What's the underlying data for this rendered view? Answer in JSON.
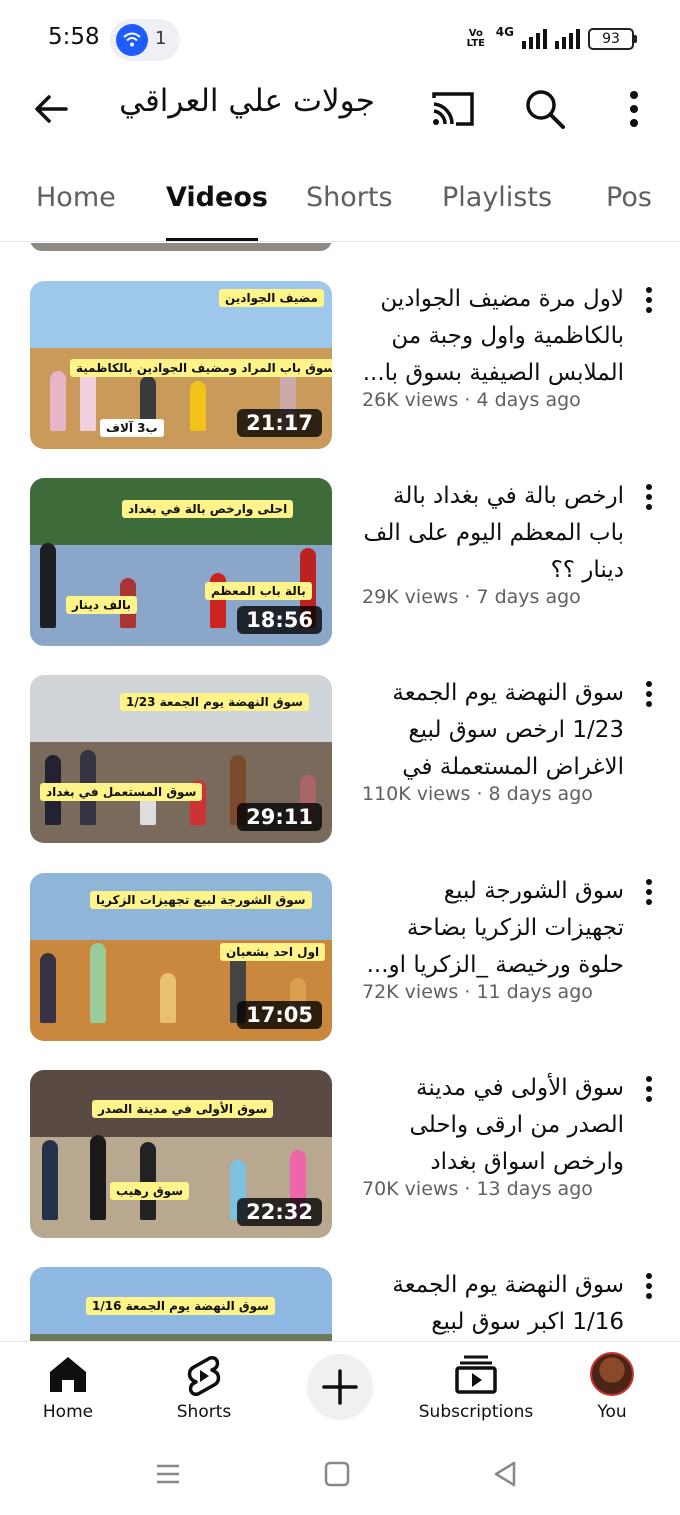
{
  "status_bar": {
    "time": "5:58",
    "notification_count": "1",
    "volte_label": "Vo LTE",
    "network_label": "4G",
    "battery": "93"
  },
  "header": {
    "channel_title": "جولات علي العراقي",
    "icons": [
      "back-arrow-icon",
      "cast-icon",
      "search-icon",
      "more-vert-icon"
    ]
  },
  "tabs": [
    {
      "label": "Home"
    },
    {
      "label": "Videos",
      "active": true
    },
    {
      "label": "Shorts"
    },
    {
      "label": "Playlists"
    },
    {
      "label": "Pos"
    }
  ],
  "videos": [
    {
      "title": "لاول مرة مضيف الجوادين بالكاظمية واول وجبة من الملابس الصيفية بسوق با...",
      "meta": "26K views · 4 days ago",
      "duration": "21:17",
      "banners": [
        "سوق باب المراد ومضيف الجوادين بالكاظمية",
        "مضيف الجوادين",
        "ب3 آلاف"
      ],
      "colors": {
        "sky": "#9ec7ec",
        "ground": "#c99a5a"
      }
    },
    {
      "title": "ارخص بالة في بغداد بالة باب المعظم اليوم على الف دينار ؟؟",
      "meta": "29K views · 7 days ago",
      "duration": "18:56",
      "banners": [
        "احلى وارخص بالة في بغداد",
        "بالة باب المعظم",
        "بالف دينار"
      ],
      "colors": {
        "sky": "#3d6b3a",
        "ground": "#8aa6c8"
      }
    },
    {
      "title": "سوق النهضة يوم الجمعة 1/23 ارخص سوق لبيع الاغراض المستعملة في بغ...",
      "meta": "110K views · 8 days ago",
      "duration": "29:11",
      "banners": [
        "سوق النهضة يوم الجمعة 1/23",
        "سوق المستعمل في بغداد"
      ],
      "colors": {
        "sky": "#cfd4d8",
        "ground": "#7a6a5c"
      }
    },
    {
      "title": "سوق الشورجة لبيع تجهيزات الزكريا بضاحة حلوة ورخيصة _الزكريا او...",
      "meta": "72K views · 11 days ago",
      "duration": "17:05",
      "banners": [
        "سوق الشورجة لبيع تجهيزات الزكريا",
        "اول احد بشعبان"
      ],
      "colors": {
        "sky": "#8fb5d9",
        "ground": "#c9883e"
      }
    },
    {
      "title": "سوق الأولى في مدينة الصدر من ارقى واحلى وارخص اسواق بغداد",
      "meta": "70K views · 13 days ago",
      "duration": "22:32",
      "banners": [
        "سوق الأولى في مدينة الصدر",
        "سوق رهيب"
      ],
      "colors": {
        "sky": "#5a4a44",
        "ground": "#b8a890"
      }
    },
    {
      "title": "سوق النهضة يوم الجمعة 1/16 اكبر سوق لبيع",
      "meta": "",
      "duration": "",
      "banners": [
        "سوق النهضة يوم الجمعة 1/16"
      ],
      "colors": {
        "sky": "#8fb9e3",
        "ground": "#6b7b5a"
      }
    }
  ],
  "bottom_nav": [
    {
      "label": "Home",
      "icon": "home-icon"
    },
    {
      "label": "Shorts",
      "icon": "shorts-icon"
    },
    {
      "label": "",
      "icon": "create-plus-icon"
    },
    {
      "label": "Subscriptions",
      "icon": "subscriptions-icon"
    },
    {
      "label": "You",
      "icon": "avatar"
    }
  ]
}
